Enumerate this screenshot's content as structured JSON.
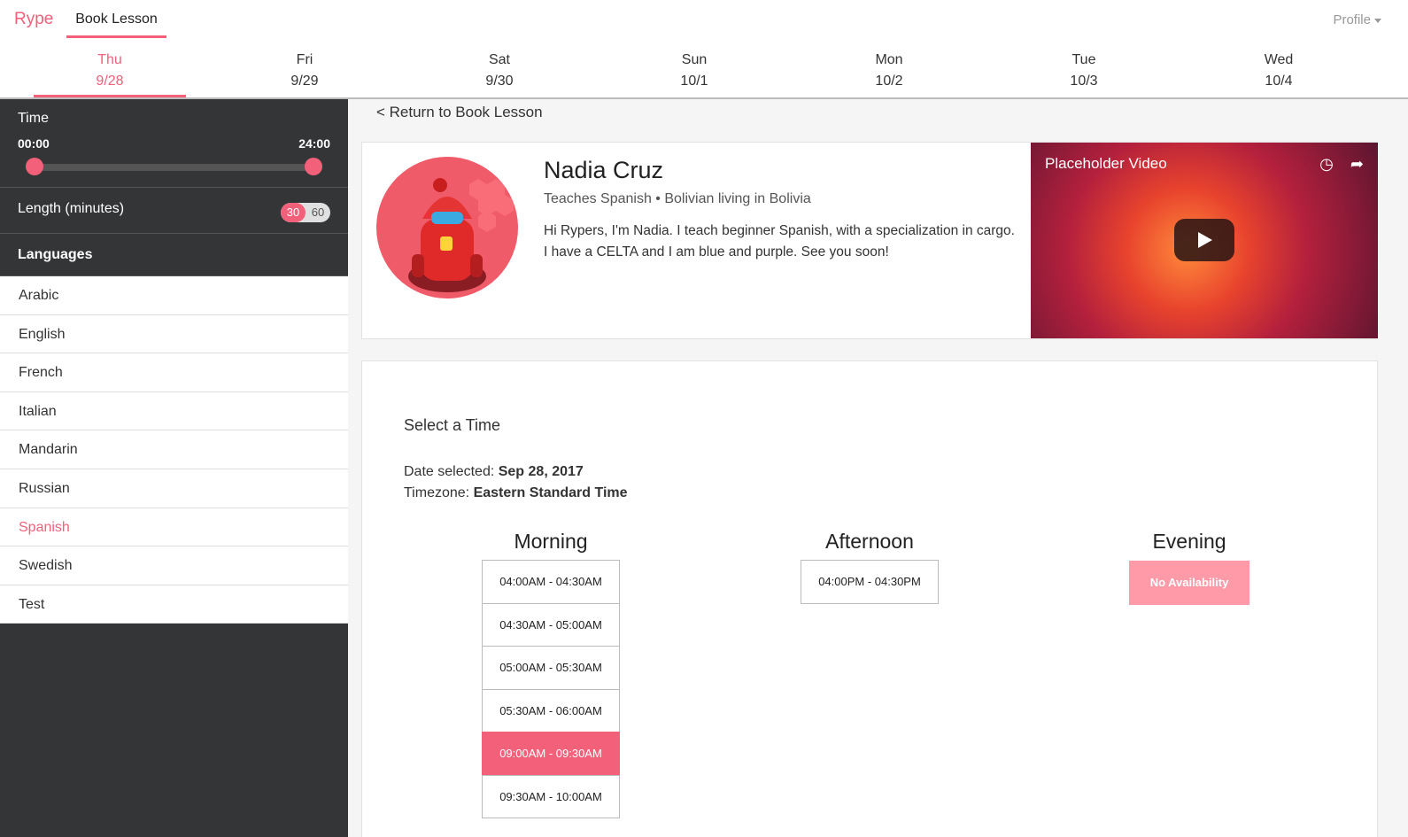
{
  "nav": {
    "brand": "Rype",
    "tab": "Book Lesson",
    "profile": "Profile"
  },
  "days": [
    {
      "name": "Thu",
      "date": "9/28"
    },
    {
      "name": "Fri",
      "date": "9/29"
    },
    {
      "name": "Sat",
      "date": "9/30"
    },
    {
      "name": "Sun",
      "date": "10/1"
    },
    {
      "name": "Mon",
      "date": "10/2"
    },
    {
      "name": "Tue",
      "date": "10/3"
    },
    {
      "name": "Wed",
      "date": "10/4"
    }
  ],
  "sidebar": {
    "time_label": "Time",
    "time_min": "00:00",
    "time_max": "24:00",
    "length_label": "Length (minutes)",
    "length_options": [
      "30",
      "60"
    ],
    "length_selected": "30",
    "languages_label": "Languages",
    "languages": [
      "Arabic",
      "English",
      "French",
      "Italian",
      "Mandarin",
      "Russian",
      "Spanish",
      "Swedish",
      "Test"
    ],
    "selected_language": "Spanish"
  },
  "back_link": "< Return to Book Lesson",
  "tutor": {
    "name": "Nadia Cruz",
    "meta": "Teaches Spanish • Bolivian living in Bolivia",
    "bio": "Hi Rypers, I'm Nadia. I teach beginner Spanish, with a specialization in cargo. I have a CELTA and I am blue and purple. See you soon!",
    "video_title": "Placeholder Video"
  },
  "schedule": {
    "heading": "Select a Time",
    "date_label": "Date selected:",
    "date_value": "Sep 28, 2017",
    "tz_label": "Timezone:",
    "tz_value": "Eastern Standard Time",
    "morning": {
      "title": "Morning",
      "slots": [
        "04:00AM - 04:30AM",
        "04:30AM - 05:00AM",
        "05:00AM - 05:30AM",
        "05:30AM - 06:00AM",
        "09:00AM - 09:30AM",
        "09:30AM - 10:00AM"
      ],
      "selected": "09:00AM - 09:30AM"
    },
    "afternoon": {
      "title": "Afternoon",
      "slots": [
        "04:00PM - 04:30PM"
      ]
    },
    "evening": {
      "title": "Evening",
      "no_availability": "No Availability"
    }
  },
  "colors": {
    "accent": "#f2607a",
    "sidebar_bg": "#333537",
    "no_avail": "#ff9aa8"
  }
}
